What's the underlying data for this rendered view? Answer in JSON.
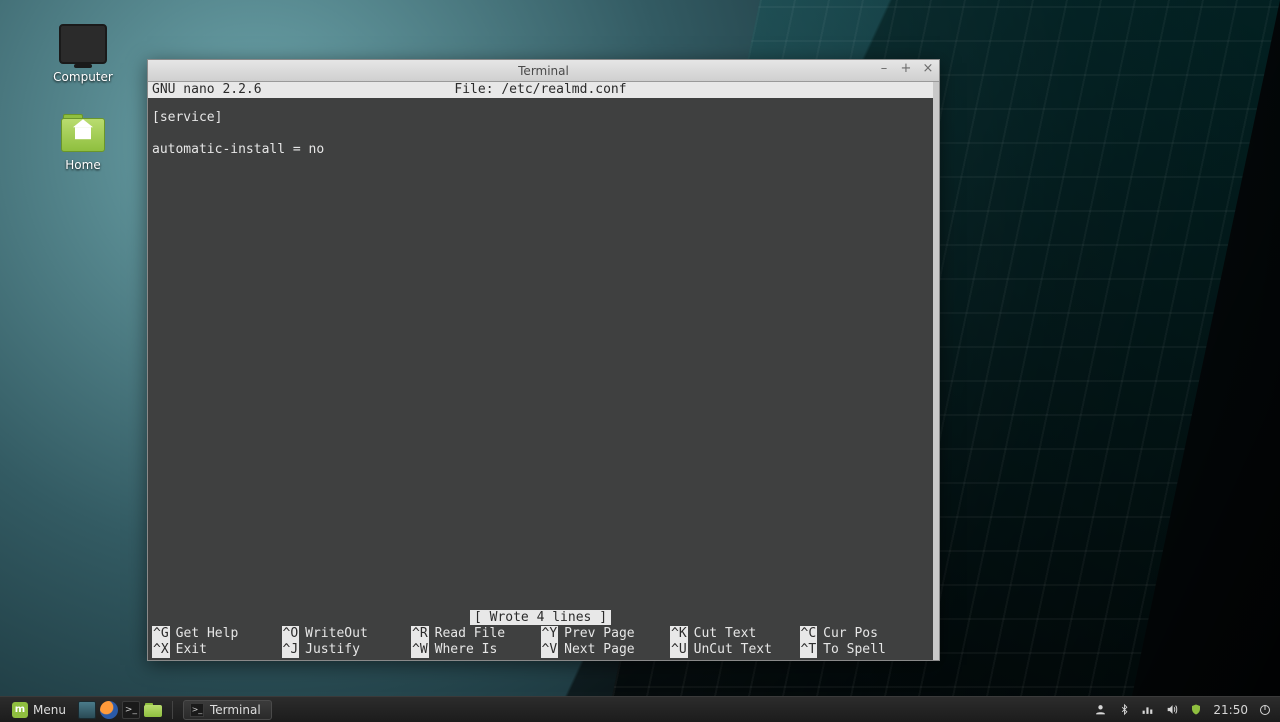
{
  "desktop_icons": {
    "computer": "Computer",
    "home": "Home"
  },
  "window": {
    "title": "Terminal"
  },
  "nano": {
    "version": "GNU nano 2.2.6",
    "file_label": "File: /etc/realmd.conf",
    "content_line1": "[service]",
    "content_line2": "automatic-install = no",
    "status": "[ Wrote 4 lines ]",
    "shortcuts": {
      "g": {
        "key": "^G",
        "label": "Get Help"
      },
      "o": {
        "key": "^O",
        "label": "WriteOut"
      },
      "r": {
        "key": "^R",
        "label": "Read File"
      },
      "y": {
        "key": "^Y",
        "label": "Prev Page"
      },
      "k": {
        "key": "^K",
        "label": "Cut Text"
      },
      "c": {
        "key": "^C",
        "label": "Cur Pos"
      },
      "x": {
        "key": "^X",
        "label": "Exit"
      },
      "j": {
        "key": "^J",
        "label": "Justify"
      },
      "w": {
        "key": "^W",
        "label": "Where Is"
      },
      "v": {
        "key": "^V",
        "label": "Next Page"
      },
      "u": {
        "key": "^U",
        "label": "UnCut Text"
      },
      "t": {
        "key": "^T",
        "label": "To Spell"
      }
    }
  },
  "taskbar": {
    "menu": "Menu",
    "task": "Terminal",
    "clock": "21:50"
  }
}
